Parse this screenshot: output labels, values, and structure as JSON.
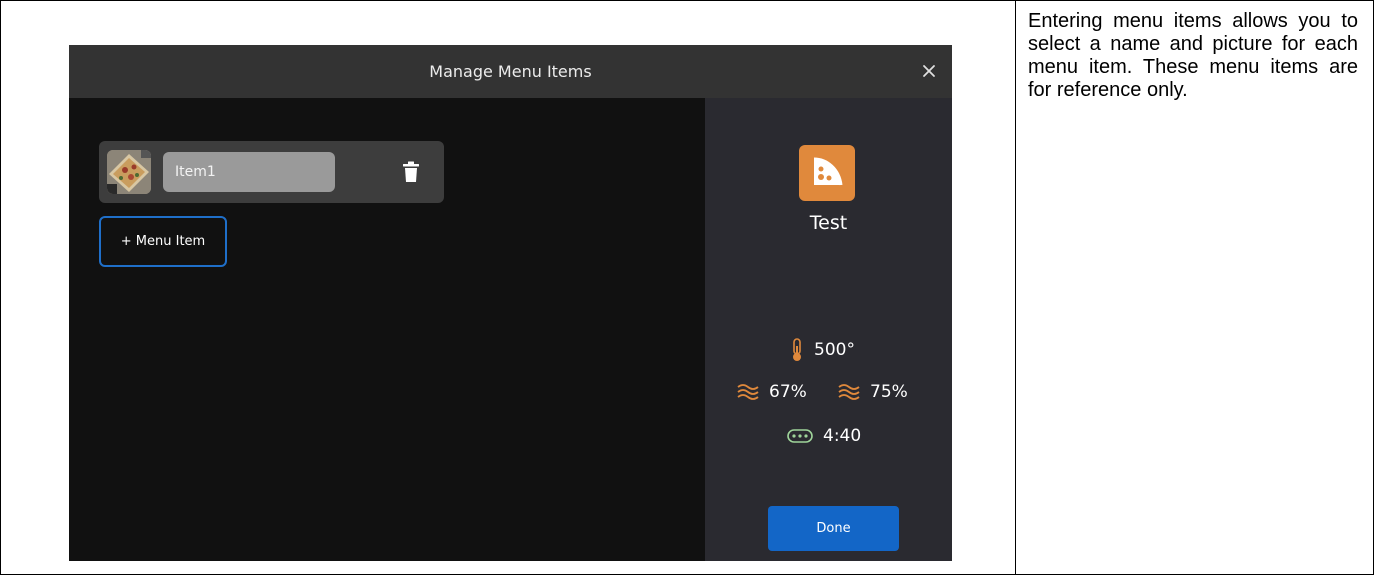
{
  "doc": {
    "description": "Entering menu items allows you to select a name and picture for each menu item. These menu items are for reference only."
  },
  "modal": {
    "title": "Manage Menu Items",
    "close_icon": "close-icon"
  },
  "menu_items": [
    {
      "name": "Item1",
      "thumbnail_icon": "pizza-photo"
    }
  ],
  "add_item_label": "+ Menu Item",
  "recipe": {
    "icon": "pizza-slice-icon",
    "name": "Test",
    "temperature": "500°",
    "humidity_1": "67%",
    "humidity_2": "75%",
    "conveyor_time": "4:40"
  },
  "done_label": "Done",
  "colors": {
    "accent_blue": "#1366c7",
    "accent_orange": "#e0893c",
    "conveyor_green": "#9fd49a"
  }
}
